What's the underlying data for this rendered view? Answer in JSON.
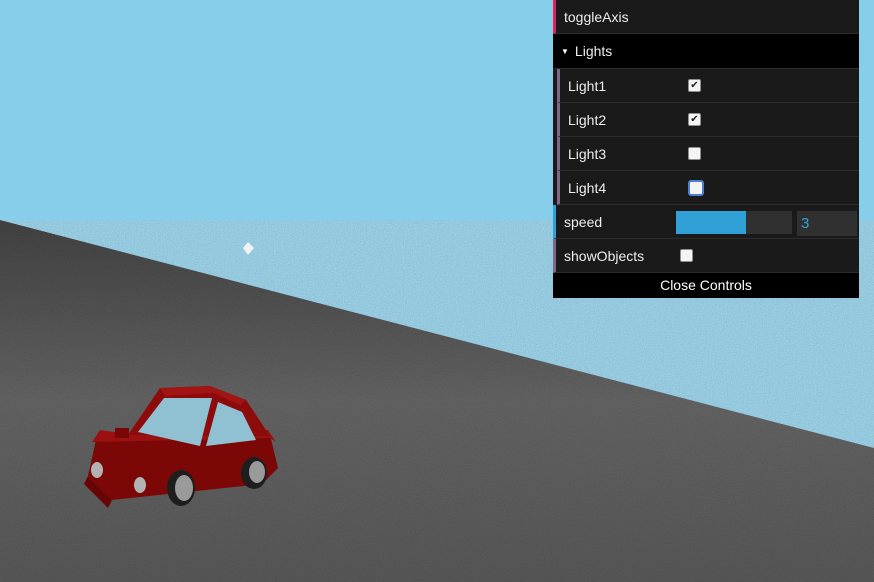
{
  "gui": {
    "toggle_axis_label": "toggleAxis",
    "lights_folder": {
      "title": "Lights",
      "items": [
        {
          "label": "Light1",
          "checked": true
        },
        {
          "label": "Light2",
          "checked": true
        },
        {
          "label": "Light3",
          "checked": false
        },
        {
          "label": "Light4",
          "checked": false
        }
      ]
    },
    "speed": {
      "label": "speed",
      "value": "3",
      "fill_fraction": 0.6
    },
    "show_objects": {
      "label": "showObjects",
      "checked": false
    },
    "close_label": "Close Controls"
  },
  "scene": {
    "sky_color": "#87ceeb",
    "ground_color": "#555555",
    "car_color": "#8b0a0a"
  }
}
